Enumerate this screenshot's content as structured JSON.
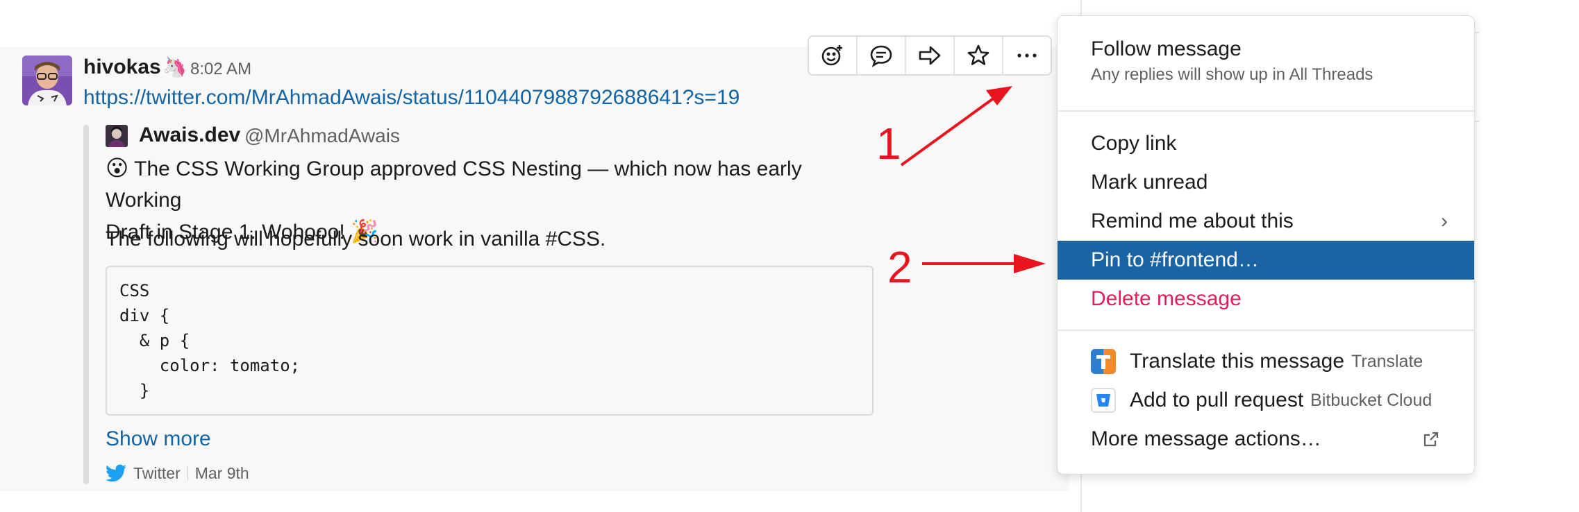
{
  "message": {
    "author": "hivokas",
    "author_emoji": "🦄",
    "time": "8:02 AM",
    "link": "https://twitter.com/MrAhmadAwais/status/1104407988792688641?s=19"
  },
  "attachment": {
    "name": "Awais.dev",
    "handle": "@MrAhmadAwais",
    "emoji_start": "😮",
    "text_part1": "The CSS Working Group approved CSS Nesting — which now has early Working",
    "text_part2": "Draft in Stage 1. Wohooo!",
    "emoji_end": "🎉",
    "line2": "The following will hopefully soon work in vanilla #CSS.",
    "code_lines": [
      "CSS",
      "div {",
      "  & p {",
      "    color: tomato;",
      "  }"
    ],
    "show_more": "Show more",
    "source": "Twitter",
    "date": "Mar 9th"
  },
  "toolbar": {
    "buttons": [
      {
        "name": "add-reaction-icon"
      },
      {
        "name": "reply-thread-icon"
      },
      {
        "name": "share-forward-icon"
      },
      {
        "name": "star-icon"
      },
      {
        "name": "more-actions-icon"
      }
    ]
  },
  "annotations": {
    "one": "1",
    "two": "2",
    "color": "#e8141e"
  },
  "menu": {
    "follow": {
      "label": "Follow message",
      "sub": "Any replies will show up in All Threads"
    },
    "copy_link": "Copy link",
    "mark_unread": "Mark unread",
    "remind": "Remind me about this",
    "pin": "Pin to #frontend…",
    "delete": "Delete message",
    "translate": {
      "label": "Translate this message",
      "app": "Translate"
    },
    "pull_request": {
      "label": "Add to pull request",
      "app": "Bitbucket Cloud"
    },
    "more": "More message actions…",
    "active_color": "#1a64a3",
    "danger_color": "#e01e5a"
  }
}
